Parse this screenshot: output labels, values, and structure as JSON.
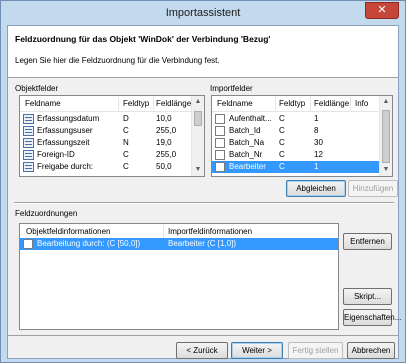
{
  "window": {
    "title": "Importassistent",
    "close_glyph": "✕"
  },
  "header": {
    "title": "Feldzuordnung für das Objekt 'WinDok' der Verbindung 'Bezug'",
    "subtitle": "Legen Sie hier die Feldzuordnung für die Verbindung fest."
  },
  "objektfelder": {
    "label": "Objektfelder",
    "columns": [
      "Feldname",
      "Feldtyp",
      "Feldlänge"
    ],
    "rows": [
      {
        "name": "Erfassungsdatum",
        "type": "D",
        "length": "10,0"
      },
      {
        "name": "Erfassungsuser",
        "type": "C",
        "length": "255,0"
      },
      {
        "name": "Erfassungszeit",
        "type": "N",
        "length": "19,0"
      },
      {
        "name": "Foreign-ID",
        "type": "C",
        "length": "255,0"
      },
      {
        "name": "Freigabe durch:",
        "type": "C",
        "length": "50,0"
      }
    ]
  },
  "importfelder": {
    "label": "Importfelder",
    "columns": [
      "Feldname",
      "Feldtyp",
      "Feldlänge",
      "Info"
    ],
    "rows": [
      {
        "name": "Aufenthalt...",
        "type": "C",
        "length": "1",
        "selected": false
      },
      {
        "name": "Batch_Id",
        "type": "C",
        "length": "8",
        "selected": false
      },
      {
        "name": "Batch_Na",
        "type": "C",
        "length": "30",
        "selected": false
      },
      {
        "name": "Batch_Nr",
        "type": "C",
        "length": "12",
        "selected": false
      },
      {
        "name": "Bearbeiter",
        "type": "C",
        "length": "1",
        "selected": true
      }
    ]
  },
  "buttons": {
    "abgleichen": "Abgleichen",
    "hinzufuegen": "Hinzufügen",
    "entfernen": "Entfernen",
    "skript": "Skript...",
    "eigenschaften": "Eigenschaften...",
    "zurueck": "< Zurück",
    "weiter": "Weiter >",
    "fertig": "Fertig stellen",
    "abbrechen": "Abbrechen"
  },
  "feldzuordnungen": {
    "label": "Feldzuordnungen",
    "columns": [
      "Objektfeldinformationen",
      "Importfeldinformationen"
    ],
    "rows": [
      {
        "objekt": "Bearbeitung durch: (C [50,0])",
        "import": "Bearbeiter (C [1,0])",
        "selected": true
      }
    ]
  },
  "scroll": {
    "up": "▲",
    "down": "▼"
  }
}
